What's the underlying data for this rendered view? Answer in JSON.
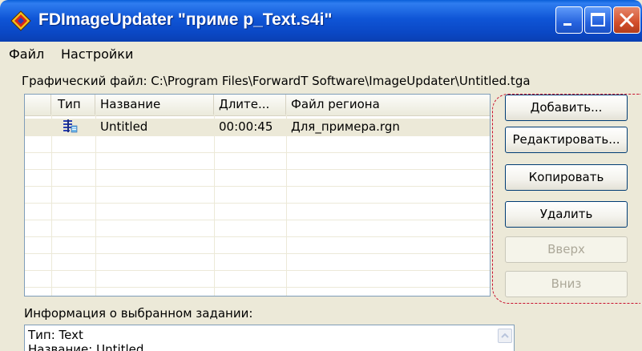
{
  "window": {
    "title": "FDImageUpdater \"приме р_Text.s4i\"",
    "controls": [
      "minimize-icon",
      "maximize-icon",
      "close-icon"
    ]
  },
  "menu": [
    "Файл",
    "Настройки"
  ],
  "graphic_file": {
    "label": "Графический файл: C:\\Program Files\\ForwardT Software\\ImageUpdater\\Untitled.tga"
  },
  "list": {
    "columns": [
      "",
      "Тип",
      "Название",
      "Длите...",
      "Файл региона"
    ],
    "rows": [
      {
        "type_icon": "text-task-icon",
        "name": "Untitled",
        "duration": "00:00:45",
        "region_file": "Для_примера.rgn",
        "selected": true
      }
    ]
  },
  "buttons": {
    "add": "Добавить...",
    "edit": "Редактировать...",
    "copy": "Копировать",
    "delete": "Удалить",
    "up": "Вверх",
    "down": "Вниз"
  },
  "info": {
    "label": "Информация о выбранном задании:",
    "lines": [
      "Тип: Text",
      "Название: Untitled"
    ]
  },
  "colors": {
    "titlebar": "#0a47c4",
    "dashed_highlight": "#c8102e",
    "selected_row": "#ece9d8"
  }
}
